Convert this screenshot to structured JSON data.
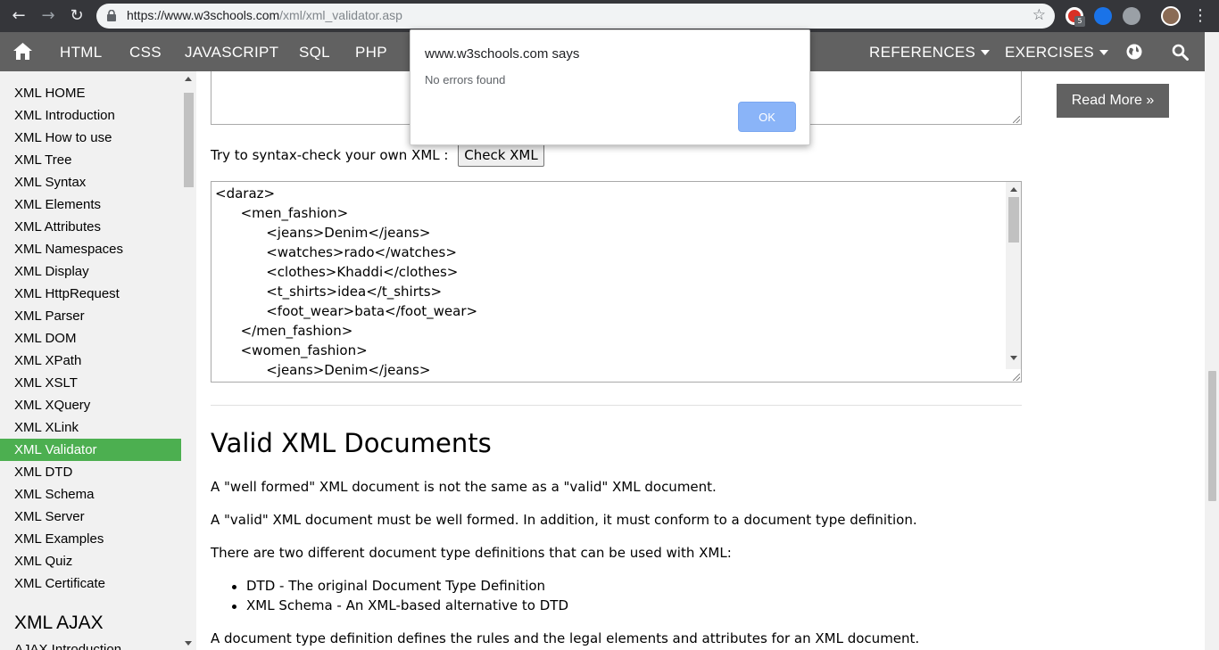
{
  "browser": {
    "url_prefix": "https://www.w3schools.com",
    "url_rest": "/xml/xml_validator.asp",
    "extension_badge": "5"
  },
  "topnav": {
    "items": [
      "HTML",
      "CSS",
      "JAVASCRIPT",
      "SQL",
      "PHP"
    ],
    "references": "REFERENCES",
    "exercises": "EXERCISES"
  },
  "sidebar": {
    "links": [
      "XML HOME",
      "XML Introduction",
      "XML How to use",
      "XML Tree",
      "XML Syntax",
      "XML Elements",
      "XML Attributes",
      "XML Namespaces",
      "XML Display",
      "XML HttpRequest",
      "XML Parser",
      "XML DOM",
      "XML XPath",
      "XML XSLT",
      "XML XQuery",
      "XML XLink",
      "XML Validator",
      "XML DTD",
      "XML Schema",
      "XML Server",
      "XML Examples",
      "XML Quiz",
      "XML Certificate"
    ],
    "active": "XML Validator",
    "section_heading": "XML AJAX",
    "cut_off_link": "AJAX Introduction"
  },
  "main": {
    "try_text": "Try to syntax-check your own XML :",
    "check_button": "Check XML",
    "xml_content": "<daraz>\n\t<men_fashion>\n\t\t<jeans>Denim</jeans>\n\t\t<watches>rado</watches>\n\t\t<clothes>Khaddi</clothes>\n\t\t<t_shirts>idea</t_shirts>\n\t\t<foot_wear>bata</foot_wear>\n\t</men_fashion>\n\t<women_fashion>\n\t\t<jeans>Denim</jeans>",
    "heading": "Valid XML Documents",
    "p1": "A \"well formed\" XML document is not the same as a \"valid\" XML document.",
    "p2": "A \"valid\" XML document must be well formed. In addition, it must conform to a document type definition.",
    "p3": "There are two different document type definitions that can be used with XML:",
    "bullets": [
      "DTD - The original Document Type Definition",
      "XML Schema - An XML-based alternative to DTD"
    ],
    "p4": "A document type definition defines the rules and the legal elements and attributes for an XML document."
  },
  "right": {
    "read_more": "Read More »"
  },
  "dialog": {
    "title": "www.w3schools.com says",
    "message": "No errors found",
    "ok": "OK"
  },
  "colors": {
    "nav_bg": "#616161",
    "active_green": "#4caf50",
    "ok_button": "#8ab4f8"
  }
}
